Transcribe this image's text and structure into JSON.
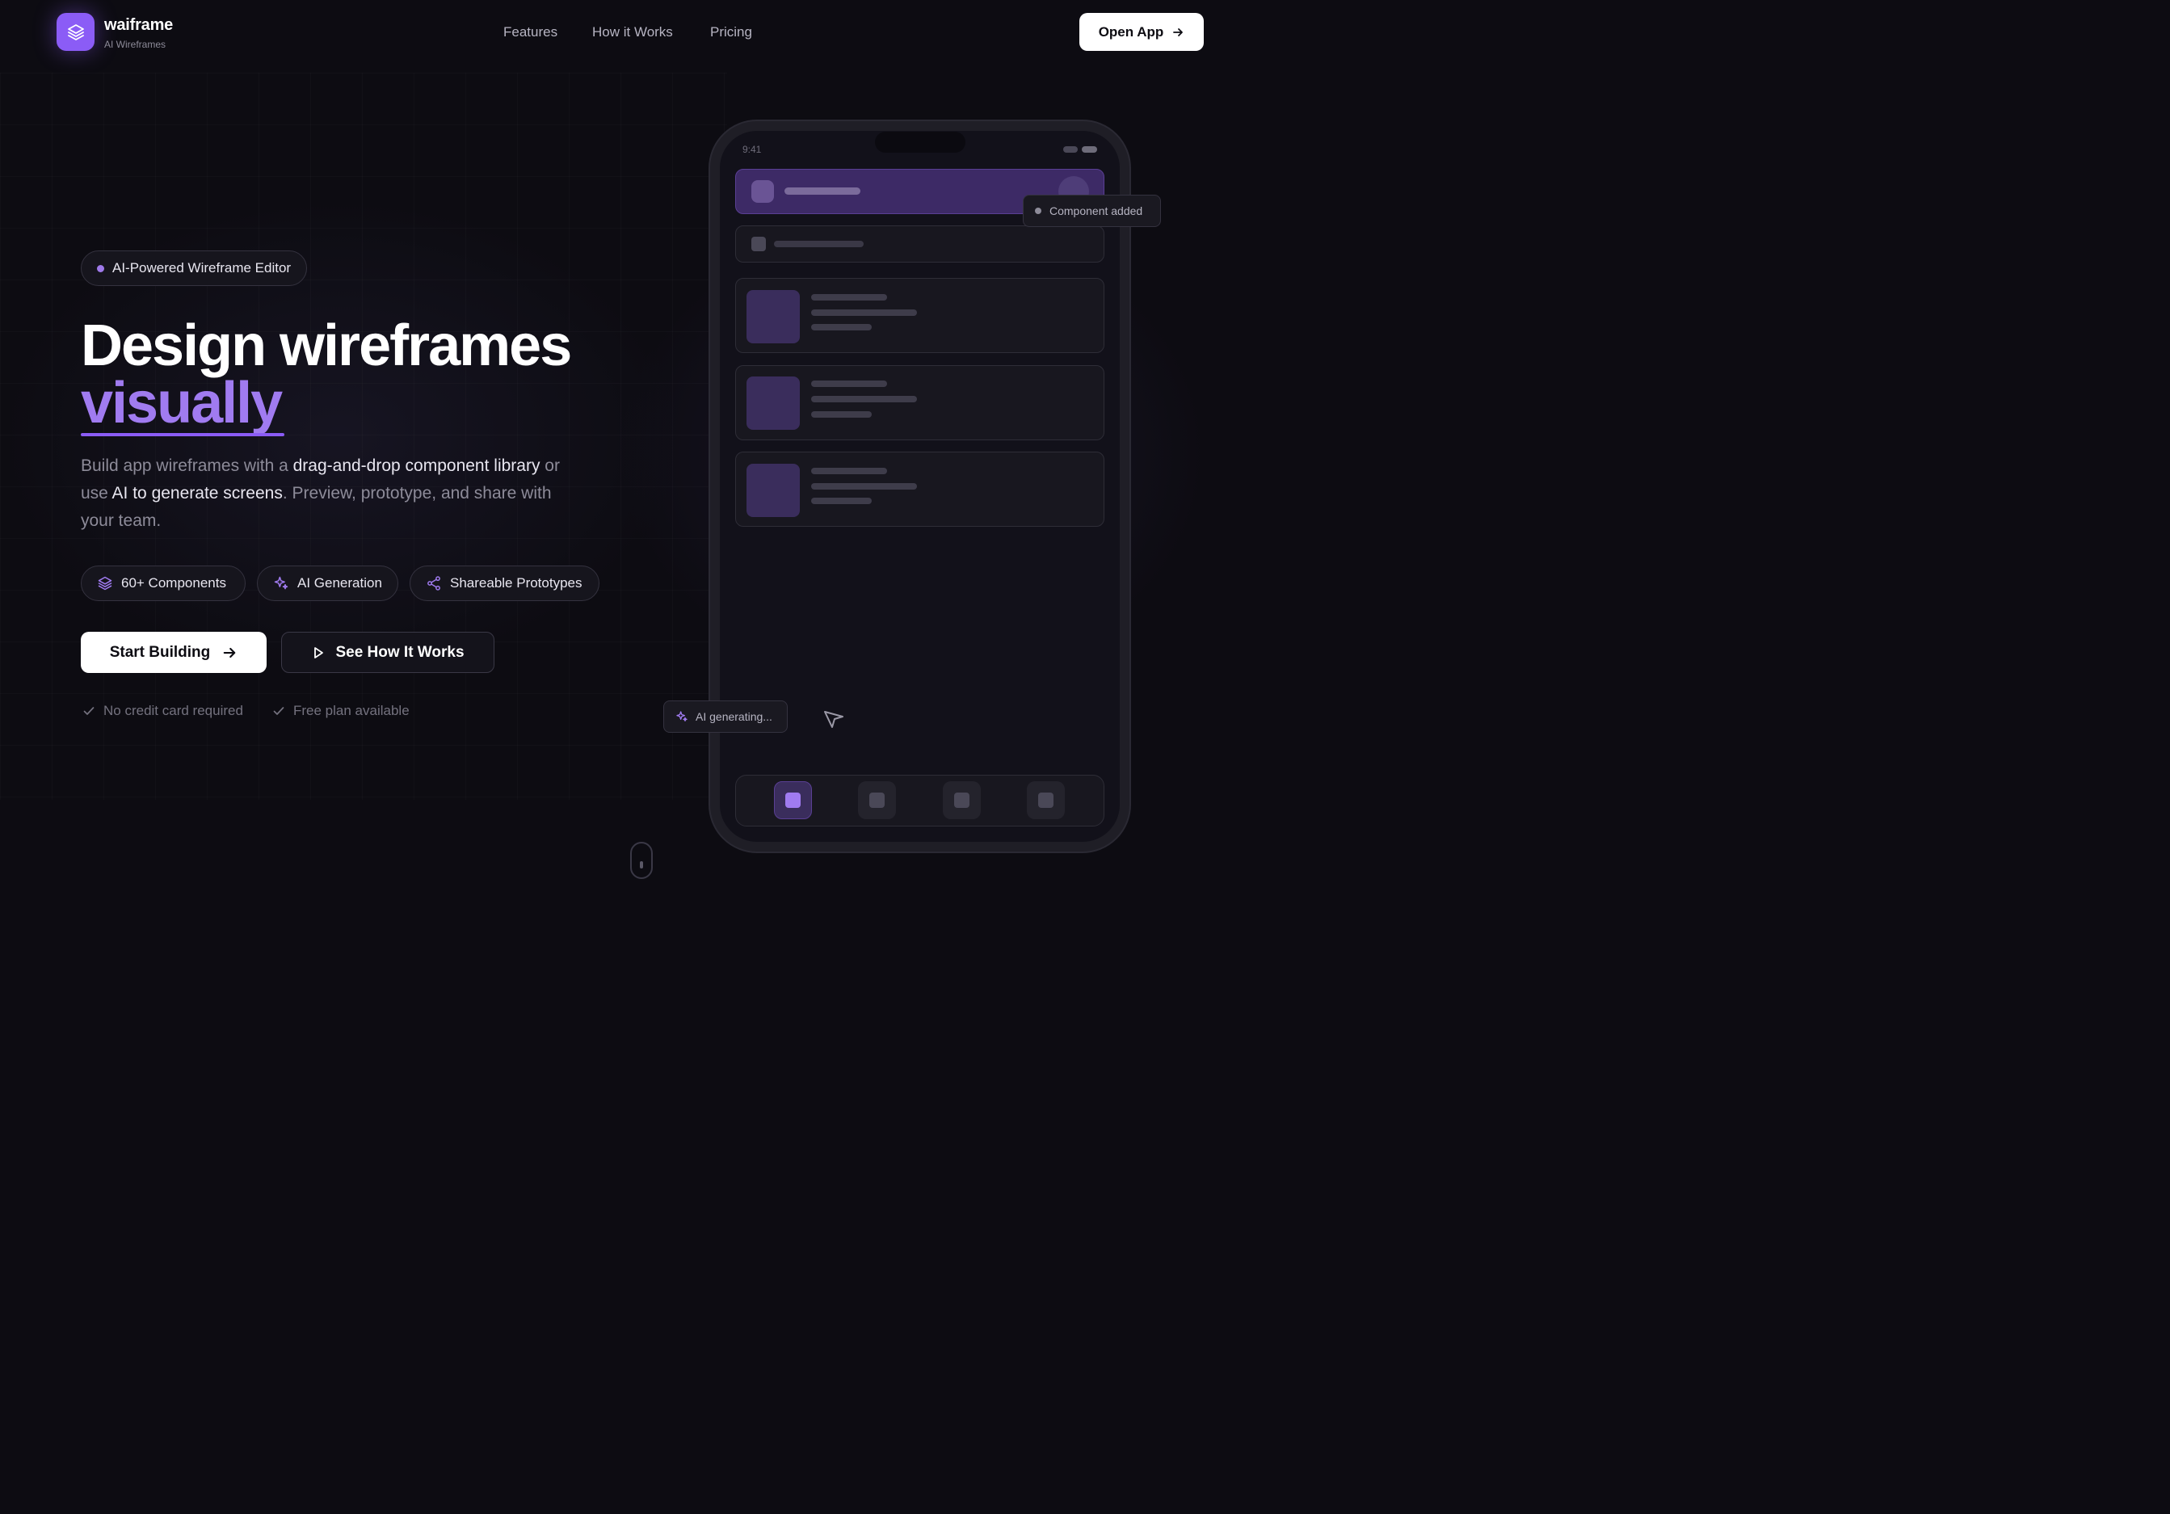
{
  "brand": {
    "name": "waiframe",
    "subtitle": "AI Wireframes",
    "logo_icon": "layers-icon",
    "accent_color": "#8b5cf6"
  },
  "nav": {
    "links": [
      {
        "label": "Features"
      },
      {
        "label": "How it Works"
      },
      {
        "label": "Pricing"
      }
    ],
    "cta_label": "Open App",
    "cta_icon": "arrow-right-icon"
  },
  "hero": {
    "badge": "AI-Powered Wireframe Editor",
    "title_line1": "Design wireframes",
    "title_line2": "visually",
    "description": {
      "p1": "Build app wireframes with a ",
      "hl1": "drag-and-drop component library",
      "p2": " or use ",
      "hl2": "AI to generate screens",
      "p3": ". Preview, prototype, and share with your team."
    },
    "features": [
      {
        "label": "60+ Components",
        "icon": "layers-icon"
      },
      {
        "label": "AI Generation",
        "icon": "sparkles-icon"
      },
      {
        "label": "Shareable Prototypes",
        "icon": "share-icon"
      }
    ],
    "primary_cta": "Start Building",
    "secondary_cta": "See How It Works",
    "assurances": [
      {
        "label": "No credit card required",
        "icon": "check-icon"
      },
      {
        "label": "Free plan available",
        "icon": "check-icon"
      }
    ]
  },
  "mockup": {
    "status_time": "9:41",
    "toast": "Component added",
    "ai_status": "AI generating...",
    "active_tab": 1,
    "tab_count": 4
  }
}
